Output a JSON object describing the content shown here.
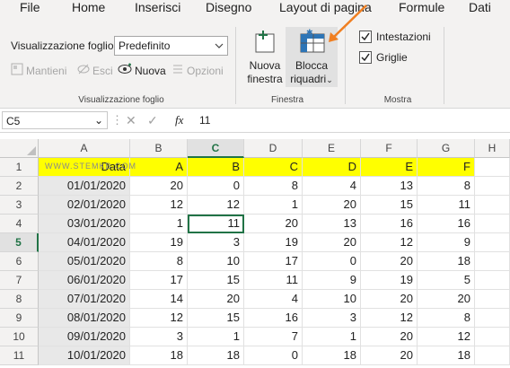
{
  "menu": [
    "File",
    "Home",
    "Inserisci",
    "Disegno",
    "Layout di pagina",
    "Formule",
    "Dati"
  ],
  "ribbon": {
    "view_label": "Visualizzazione foglio",
    "view_value": "Predefinito",
    "keep_label": "Mantieni",
    "exit_label": "Esci",
    "new_label": "Nuova",
    "options_label": "Opzioni",
    "group1_label": "Visualizzazione foglio",
    "new_window_line1": "Nuova",
    "new_window_line2": "finestra",
    "freeze_line1": "Blocca",
    "freeze_line2": "riquadri",
    "group2_label": "Finestra",
    "headings_label": "Intestazioni",
    "gridlines_label": "Griglie",
    "group3_label": "Mostra",
    "accent": "#217346",
    "arrow_color": "#f07f21"
  },
  "formula_bar": {
    "name_box": "C5",
    "fx": "fx",
    "value": "11"
  },
  "watermark": "WWW.STEMKB.COM",
  "columns": [
    "A",
    "B",
    "C",
    "D",
    "E",
    "F",
    "G",
    "H"
  ],
  "selected_column": "C",
  "rows": [
    "1",
    "2",
    "3",
    "4",
    "5",
    "6",
    "7",
    "8",
    "9",
    "10",
    "11"
  ],
  "selected_row": "5",
  "table": {
    "headers": [
      "Data",
      "A",
      "B",
      "C",
      "D",
      "E",
      "F"
    ],
    "data": [
      [
        "01/01/2020",
        "20",
        "0",
        "8",
        "4",
        "13",
        "8"
      ],
      [
        "02/01/2020",
        "12",
        "12",
        "1",
        "20",
        "15",
        "11"
      ],
      [
        "03/01/2020",
        "1",
        "11",
        "20",
        "13",
        "16",
        "16"
      ],
      [
        "04/01/2020",
        "19",
        "3",
        "19",
        "20",
        "12",
        "9"
      ],
      [
        "05/01/2020",
        "8",
        "10",
        "17",
        "0",
        "20",
        "18"
      ],
      [
        "06/01/2020",
        "17",
        "15",
        "11",
        "9",
        "19",
        "5"
      ],
      [
        "07/01/2020",
        "14",
        "20",
        "4",
        "10",
        "20",
        "20"
      ],
      [
        "08/01/2020",
        "12",
        "15",
        "16",
        "3",
        "12",
        "8"
      ],
      [
        "09/01/2020",
        "3",
        "1",
        "7",
        "1",
        "20",
        "12"
      ],
      [
        "10/01/2020",
        "18",
        "18",
        "0",
        "18",
        "20",
        "18"
      ]
    ]
  }
}
